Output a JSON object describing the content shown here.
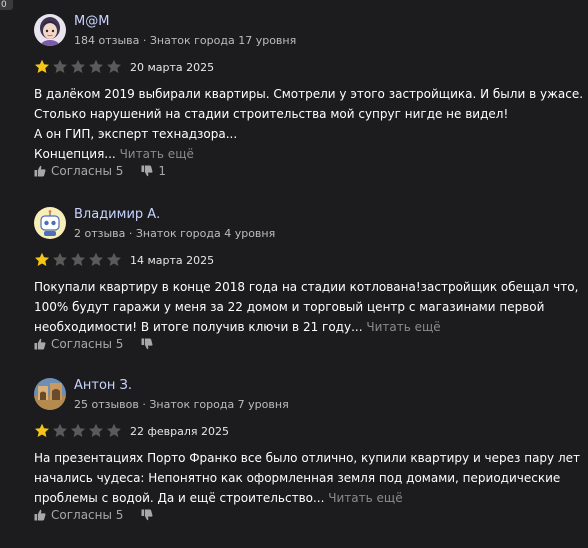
{
  "edge_badge": "0",
  "read_more_label": "Читать ещё",
  "colors": {
    "background": "#1c1c1e",
    "author_name": "#c9d4ff",
    "star_filled": "#f5c518",
    "star_empty": "#5a5a5a",
    "muted_text": "#8a8a8a"
  },
  "reviews": [
    {
      "author_name": "М@М",
      "author_meta": "184 отзыва · Знаток города 17 уровня",
      "avatar_icon": "avatar-girl-icon",
      "rating": 1,
      "rating_max": 5,
      "date": "20 марта 2025",
      "text_lines": [
        "В далёком 2019 выбирали квартиры. Смотрели у этого застройщика. И были в ужасе.",
        "Столько нарушений на стадии строительства мой супруг нигде не видел!",
        "А он ГИП, эксперт технадзора...",
        "Концепция..."
      ],
      "likes_label": "Согласны 5",
      "dislikes_count": "1"
    },
    {
      "author_name": "Владимир А.",
      "author_meta": "2 отзыва · Знаток города 4 уровня",
      "avatar_icon": "avatar-robot-icon",
      "rating": 1,
      "rating_max": 5,
      "date": "14 марта 2025",
      "text_lines": [
        "Покупали квартиру в конце 2018 года на стадии котлована!застройщик обещал что,",
        "100% будут гаражи у меня за 22 домом и торговый центр с магазинами первой",
        "необходимости! В итоге получив ключи в 21 году..."
      ],
      "likes_label": "Согласны 5",
      "dislikes_count": ""
    },
    {
      "author_name": "Антон З.",
      "author_meta": "25 отзывов · Знаток города 7 уровня",
      "avatar_icon": "avatar-photo-icon",
      "rating": 1,
      "rating_max": 5,
      "date": "22 февраля 2025",
      "text_lines": [
        "На презентациях Порто Франко все было отлично, купили квартиру и через пару лет",
        "начались чудеса: Непонятно как оформленная земля под домами, периодические",
        "проблемы с водой. Да и ещё строительство..."
      ],
      "likes_label": "Согласны 5",
      "dislikes_count": ""
    }
  ]
}
